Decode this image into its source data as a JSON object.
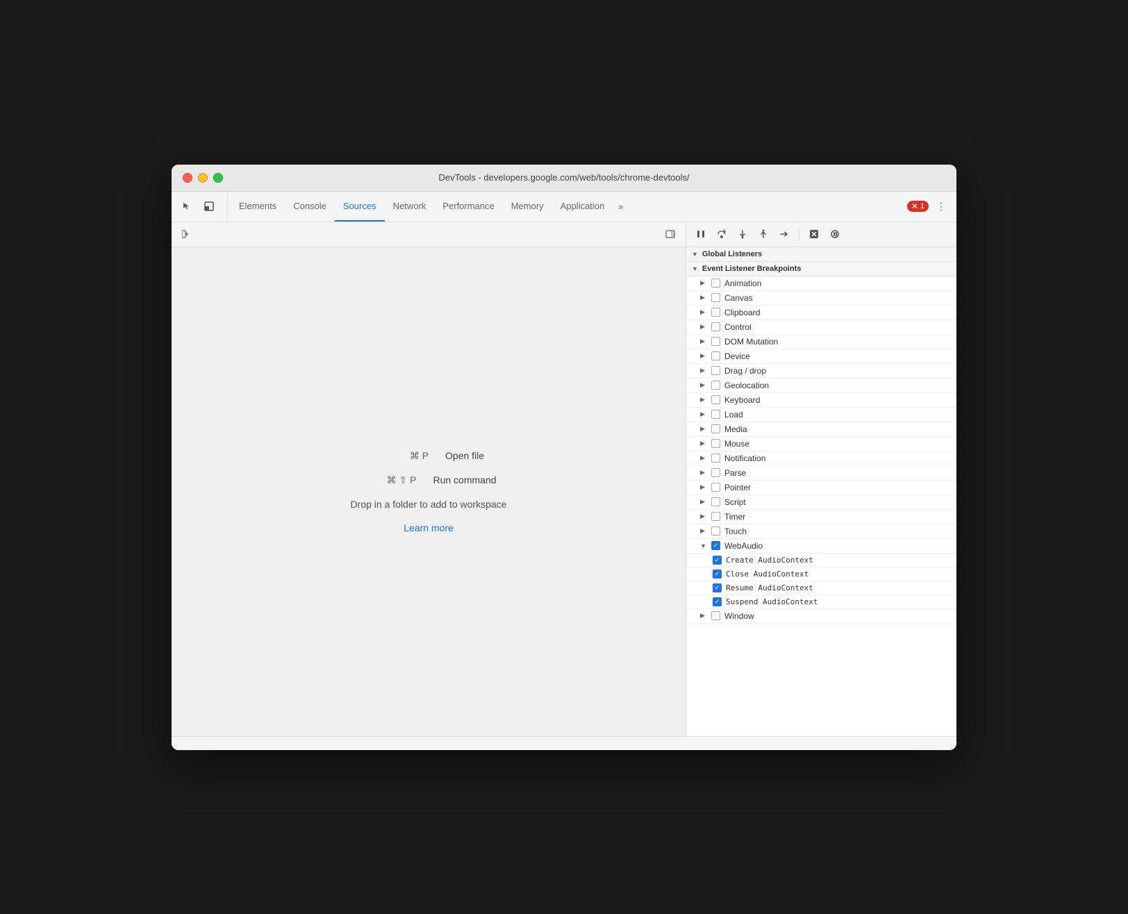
{
  "window": {
    "title": "DevTools - developers.google.com/web/tools/chrome-devtools/"
  },
  "traffic_lights": {
    "close_label": "close",
    "minimize_label": "minimize",
    "maximize_label": "maximize"
  },
  "tabs": [
    {
      "id": "elements",
      "label": "Elements",
      "active": false
    },
    {
      "id": "console",
      "label": "Console",
      "active": false
    },
    {
      "id": "sources",
      "label": "Sources",
      "active": true
    },
    {
      "id": "network",
      "label": "Network",
      "active": false
    },
    {
      "id": "performance",
      "label": "Performance",
      "active": false
    },
    {
      "id": "memory",
      "label": "Memory",
      "active": false
    },
    {
      "id": "application",
      "label": "Application",
      "active": false
    }
  ],
  "tabs_more": "⋯",
  "error_badge": "1",
  "left_panel": {
    "open_file_keys": "⌘ P",
    "open_file_label": "Open file",
    "run_command_keys": "⌘ ⇧ P",
    "run_command_label": "Run command",
    "drop_text": "Drop in a folder to add to workspace",
    "learn_more": "Learn more"
  },
  "right_panel": {
    "section_label": "Event Listener Breakpoints",
    "breakpoints": [
      {
        "id": "animation",
        "label": "Animation",
        "checked": false,
        "expanded": false,
        "children": []
      },
      {
        "id": "canvas",
        "label": "Canvas",
        "checked": false,
        "expanded": false,
        "children": []
      },
      {
        "id": "clipboard",
        "label": "Clipboard",
        "checked": false,
        "expanded": false,
        "children": []
      },
      {
        "id": "control",
        "label": "Control",
        "checked": false,
        "expanded": false,
        "children": []
      },
      {
        "id": "dom-mutation",
        "label": "DOM Mutation",
        "checked": false,
        "expanded": false,
        "children": []
      },
      {
        "id": "device",
        "label": "Device",
        "checked": false,
        "expanded": false,
        "children": []
      },
      {
        "id": "drag-drop",
        "label": "Drag / drop",
        "checked": false,
        "expanded": false,
        "children": []
      },
      {
        "id": "geolocation",
        "label": "Geolocation",
        "checked": false,
        "expanded": false,
        "children": []
      },
      {
        "id": "keyboard",
        "label": "Keyboard",
        "checked": false,
        "expanded": false,
        "children": []
      },
      {
        "id": "load",
        "label": "Load",
        "checked": false,
        "expanded": false,
        "children": []
      },
      {
        "id": "media",
        "label": "Media",
        "checked": false,
        "expanded": false,
        "children": []
      },
      {
        "id": "mouse",
        "label": "Mouse",
        "checked": false,
        "expanded": false,
        "children": []
      },
      {
        "id": "notification",
        "label": "Notification",
        "checked": false,
        "expanded": false,
        "children": []
      },
      {
        "id": "parse",
        "label": "Parse",
        "checked": false,
        "expanded": false,
        "children": []
      },
      {
        "id": "pointer",
        "label": "Pointer",
        "checked": false,
        "expanded": false,
        "children": []
      },
      {
        "id": "script",
        "label": "Script",
        "checked": false,
        "expanded": false,
        "children": []
      },
      {
        "id": "timer",
        "label": "Timer",
        "checked": false,
        "expanded": false,
        "children": []
      },
      {
        "id": "touch",
        "label": "Touch",
        "checked": false,
        "expanded": false,
        "children": []
      },
      {
        "id": "webaudio",
        "label": "WebAudio",
        "checked": true,
        "expanded": true,
        "children": [
          {
            "id": "create-audio-context",
            "label": "Create AudioContext",
            "checked": true
          },
          {
            "id": "close-audio-context",
            "label": "Close AudioContext",
            "checked": true
          },
          {
            "id": "resume-audio-context",
            "label": "Resume AudioContext",
            "checked": true
          },
          {
            "id": "suspend-audio-context",
            "label": "Suspend AudioContext",
            "checked": true
          }
        ]
      },
      {
        "id": "window",
        "label": "Window",
        "checked": false,
        "expanded": false,
        "children": []
      }
    ]
  },
  "colors": {
    "accent": "#1a73e8",
    "checked_bg": "#1a73e8",
    "error": "#d93025"
  }
}
